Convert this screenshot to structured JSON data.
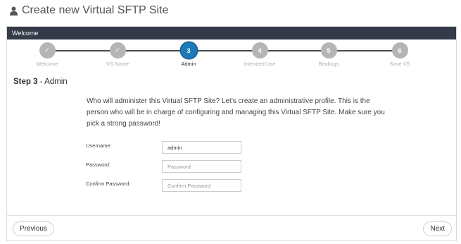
{
  "page": {
    "title": "Create new Virtual SFTP Site",
    "icon": "user-icon"
  },
  "wizard": {
    "header": "Welcome",
    "steps": [
      {
        "number": "✓",
        "label": "Welcome",
        "status": "completed"
      },
      {
        "number": "✓",
        "label": "VS Name",
        "status": "completed"
      },
      {
        "number": "3",
        "label": "Admin",
        "status": "active"
      },
      {
        "number": "4",
        "label": "Intended Use",
        "status": "pending"
      },
      {
        "number": "5",
        "label": "Bindings",
        "status": "pending"
      },
      {
        "number": "6",
        "label": "Save VS",
        "status": "pending"
      }
    ],
    "step_title": {
      "prefix": "Step 3",
      "suffix": " - Admin"
    },
    "intro": "Who will administer this Virtual SFTP Site? Let's create an administrative profile. This is the person who will be in charge of configuring and managing this Virtual SFTP Site. Make sure you pick a strong password!",
    "fields": {
      "username": {
        "label": "Username:",
        "value": "admin",
        "placeholder": ""
      },
      "password": {
        "label": "Password:",
        "value": "",
        "placeholder": "Password"
      },
      "confirm": {
        "label": "Confirm Password:",
        "value": "",
        "placeholder": "Confirm Password"
      }
    },
    "buttons": {
      "previous": "Previous",
      "next": "Next"
    }
  },
  "colors": {
    "header_bg": "#343a48",
    "active_step": "#1d7ab8",
    "inactive_step": "#b5b5b5"
  }
}
